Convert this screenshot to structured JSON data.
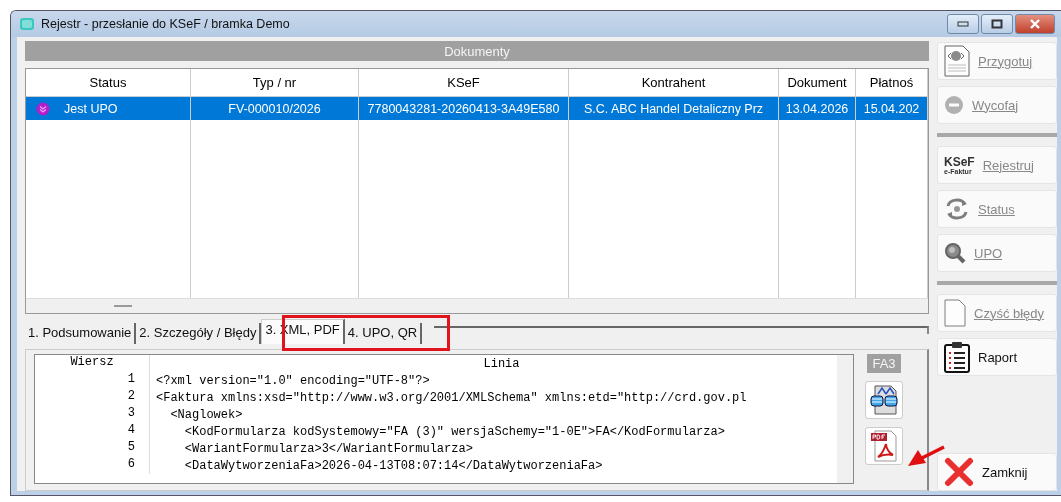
{
  "window": {
    "title": "Rejestr - przesłanie do KSeF / bramka Demo"
  },
  "documents": {
    "title": "Dokumenty",
    "columns": [
      "Status",
      "Typ / nr",
      "KSeF",
      "Kontrahent",
      "Dokument",
      "Płatnoś"
    ],
    "rows": [
      {
        "selected": true,
        "color": "#b01fc8",
        "cells": [
          "Jest UPO",
          "FV-000010/2026",
          "7780043281-20260413-3A49E580",
          "S.C. ABC Handel Detaliczny Prz",
          "13.04.2026",
          "15.04.202"
        ]
      }
    ]
  },
  "tabs": [
    {
      "label": "1. Podsumowanie",
      "selected": false
    },
    {
      "label": "2. Szczegóły / Błędy",
      "selected": false
    },
    {
      "label": "3. XML, PDF",
      "selected": true
    },
    {
      "label": "4. UPO, QR",
      "selected": false
    }
  ],
  "xml_view": {
    "columns": [
      "Wiersz",
      "Linia"
    ],
    "lines": [
      {
        "no": "1",
        "text": "<?xml version=\"1.0\" encoding=\"UTF-8\"?>"
      },
      {
        "no": "2",
        "text": "<Faktura xmlns:xsd=\"http://www.w3.org/2001/XMLSchema\" xmlns:etd=\"http://crd.gov.pl"
      },
      {
        "no": "3",
        "text": "  <Naglowek>"
      },
      {
        "no": "4",
        "text": "    <KodFormularza kodSystemowy=\"FA (3)\" wersjaSchemy=\"1-0E\">FA</KodFormularza>"
      },
      {
        "no": "5",
        "text": "    <WariantFormularza>3</WariantFormularza>"
      },
      {
        "no": "6",
        "text": "    <DataWytworzeniaFa>2026-04-13T08:07:14</DataWytworzeniaFa>"
      }
    ],
    "schema_label": "FA3"
  },
  "actions": [
    {
      "kind": "prepare",
      "label": "Przygotuj",
      "disabled": true
    },
    {
      "kind": "withdraw",
      "label": "Wycofaj",
      "disabled": true
    },
    {
      "kind": "separator"
    },
    {
      "kind": "register",
      "label": "Rejestruj",
      "disabled": true,
      "logo_top": "KSeF",
      "logo_bottom": "e-Faktur"
    },
    {
      "kind": "status",
      "label": "Status",
      "disabled": true
    },
    {
      "kind": "upo",
      "label": "UPO",
      "disabled": true
    },
    {
      "kind": "separator"
    },
    {
      "kind": "clear",
      "label": "Czyść błędy",
      "disabled": true
    },
    {
      "kind": "report",
      "label": "Raport",
      "disabled": false
    },
    {
      "kind": "spacer"
    },
    {
      "kind": "close",
      "label": "Zamknij",
      "disabled": false
    }
  ]
}
